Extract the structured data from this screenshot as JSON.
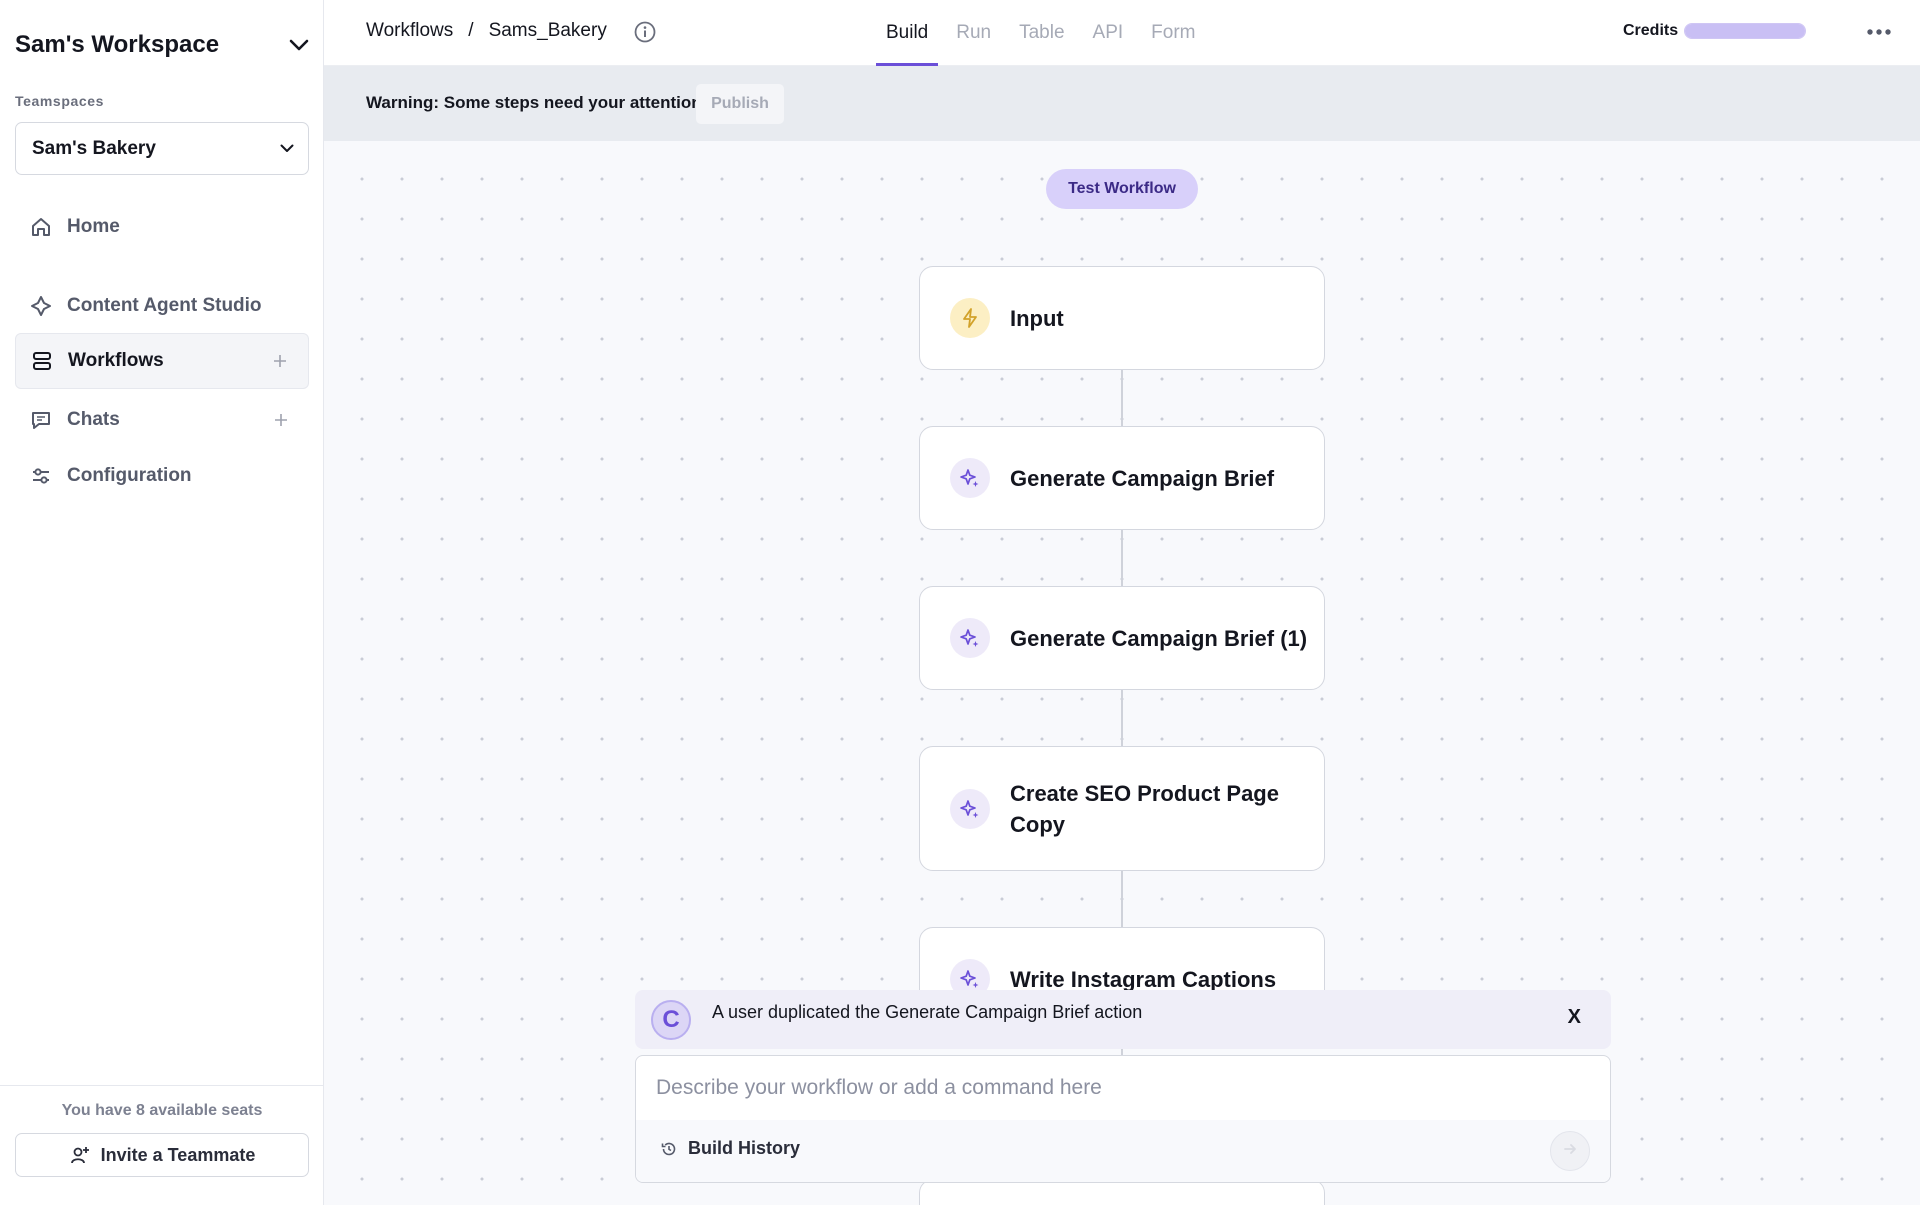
{
  "sidebar": {
    "workspace_title": "Sam's Workspace",
    "teamspaces_label": "Teamspaces",
    "teamspace_selected": "Sam's Bakery",
    "nav": [
      {
        "label": "Home",
        "icon": "home-icon"
      },
      {
        "label": "Content Agent Studio",
        "icon": "agent-icon"
      },
      {
        "label": "Workflows",
        "icon": "workflows-icon",
        "active": true
      },
      {
        "label": "Chats",
        "icon": "chat-icon"
      },
      {
        "label": "Configuration",
        "icon": "sliders-icon"
      }
    ],
    "seats_text": "You have 8 available seats",
    "invite_label": "Invite a Teammate"
  },
  "header": {
    "breadcrumb": [
      "Workflows",
      "Sams_Bakery"
    ],
    "breadcrumb_separator": "/",
    "tabs": [
      "Build",
      "Run",
      "Table",
      "API",
      "Form"
    ],
    "active_tab": "Build",
    "credits_label": "Credits",
    "credits_level": 1.0
  },
  "warning": {
    "text": "Warning: Some steps need your attention",
    "publish_label": "Publish"
  },
  "canvas": {
    "test_button": "Test Workflow",
    "nodes": [
      {
        "label": "Input",
        "icon": "bolt-icon"
      },
      {
        "label": "Generate Campaign Brief",
        "icon": "sparkle-icon"
      },
      {
        "label": "Generate Campaign Brief (1)",
        "icon": "sparkle-icon"
      },
      {
        "label": "Create SEO Product Page Copy",
        "icon": "sparkle-icon"
      },
      {
        "label": "Write Instagram Captions",
        "icon": "sparkle-icon"
      }
    ]
  },
  "notification": {
    "avatar_letter": "C",
    "message": "A user duplicated the Generate Campaign Brief action",
    "close_label": "X"
  },
  "command": {
    "placeholder": "Describe your workflow or add a command here",
    "value": "",
    "history_label": "Build History"
  },
  "colors": {
    "accent": "#6b4fd8",
    "test_button_bg": "#d8d0fa",
    "canvas_bg": "#f8f9fc",
    "warning_bg": "#e8ebf0"
  }
}
